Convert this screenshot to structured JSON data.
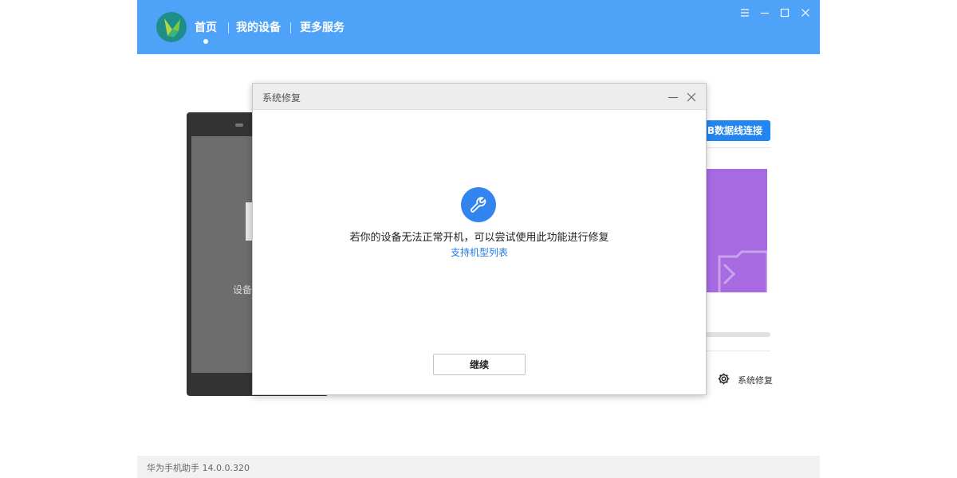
{
  "app": {
    "nav": {
      "home": "首页",
      "my_devices": "我的设备",
      "more_services": "更多服务"
    },
    "window_controls": [
      "menu-icon",
      "minimize-icon",
      "maximize-icon",
      "close-icon"
    ],
    "phone_text": "设备",
    "usb_button_label": "B数据线连接",
    "system_repair_label": "系统修复",
    "footer_version": "华为手机助手 14.0.0.320"
  },
  "dialog": {
    "title": "系统修复",
    "icon": "wrench-icon",
    "message": "若你的设备无法正常开机，可以尝试使用此功能进行修复",
    "link": "支持机型列表",
    "continue_label": "继续"
  },
  "colors": {
    "header": "#4ea2f7",
    "accent": "#3284ee",
    "link": "#1e7be0",
    "promo": "#a86ae1"
  }
}
